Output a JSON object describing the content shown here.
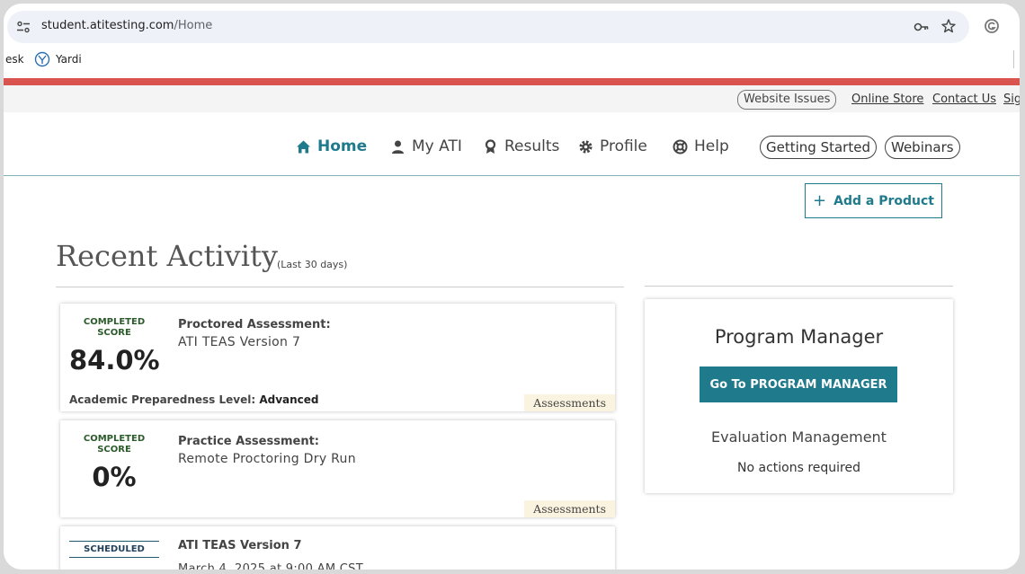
{
  "browser": {
    "url_domain": "student.atitesting.com",
    "url_path": "/Home",
    "bookmarks": [
      {
        "label": "esk"
      },
      {
        "label": "Yardi",
        "icon": "yardi-icon"
      }
    ]
  },
  "utility_nav": {
    "website_issues": "Website Issues",
    "online_store": "Online Store",
    "contact_us": "Contact Us",
    "sign_in_partial": "Sig"
  },
  "main_nav": {
    "items": [
      {
        "label": "Home",
        "icon": "home-icon",
        "active": true
      },
      {
        "label": "My ATI",
        "icon": "person-icon"
      },
      {
        "label": "Results",
        "icon": "ribbon-icon"
      },
      {
        "label": "Profile",
        "icon": "gear-icon"
      },
      {
        "label": "Help",
        "icon": "lifebuoy-icon"
      }
    ],
    "getting_started": "Getting Started",
    "webinars": "Webinars"
  },
  "add_product": {
    "label": "Add a Product"
  },
  "recent_activity": {
    "title": "Recent Activity",
    "subtitle": "(Last 30 days)",
    "cards": [
      {
        "status": "COMPLETED SCORE",
        "score": "84.0%",
        "type": "Proctored Assessment:",
        "name": "ATI TEAS Version 7",
        "academic_label": "Academic Preparedness Level:",
        "academic_value": "Advanced",
        "tag": "Assessments"
      },
      {
        "status": "COMPLETED SCORE",
        "score": "0%",
        "type": "Practice Assessment:",
        "name": "Remote Proctoring Dry Run",
        "tag": "Assessments"
      },
      {
        "status": "SCHEDULED",
        "name": "ATI TEAS Version 7",
        "detail_partial": "March 4, 2025 at 9:00 AM CST"
      }
    ]
  },
  "program_manager": {
    "title": "Program Manager",
    "button": "Go To PROGRAM MANAGER",
    "evaluation": "Evaluation Management",
    "status": "No actions required"
  },
  "colors": {
    "accent": "#1f7a8c",
    "red_bar": "#d9534f",
    "tag_bg": "#faf3e0"
  }
}
